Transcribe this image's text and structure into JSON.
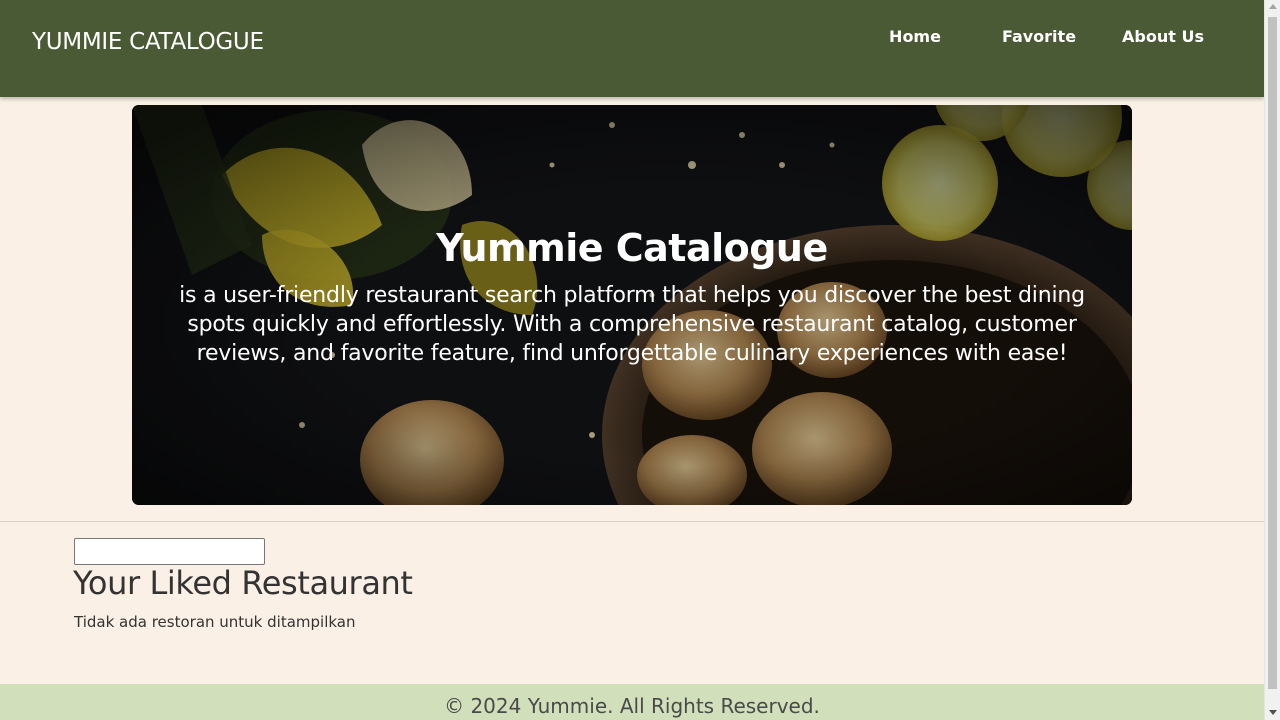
{
  "header": {
    "brand": "YUMMIE CATALOGUE",
    "nav": {
      "home": "Home",
      "favorite": "Favorite",
      "about": "About Us"
    }
  },
  "hero": {
    "title": "Yummie Catalogue",
    "description": "is a user-friendly restaurant search platform that helps you discover the best dining spots quickly and effortlessly. With a comprehensive restaurant catalog, customer reviews, and favorite feature, find unforgettable culinary experiences with ease!",
    "image": "food-background-image"
  },
  "main": {
    "search": {
      "value": "",
      "placeholder": ""
    },
    "section_title": "Your Liked Restaurant",
    "empty_message": "Tidak ada restoran untuk ditampilkan"
  },
  "footer": {
    "copyright": "© 2024 Yummie. All Rights Reserved."
  },
  "colors": {
    "header_bg": "#4A5A35",
    "page_bg": "#FAF0E6",
    "footer_bg": "#D1DFBB"
  }
}
